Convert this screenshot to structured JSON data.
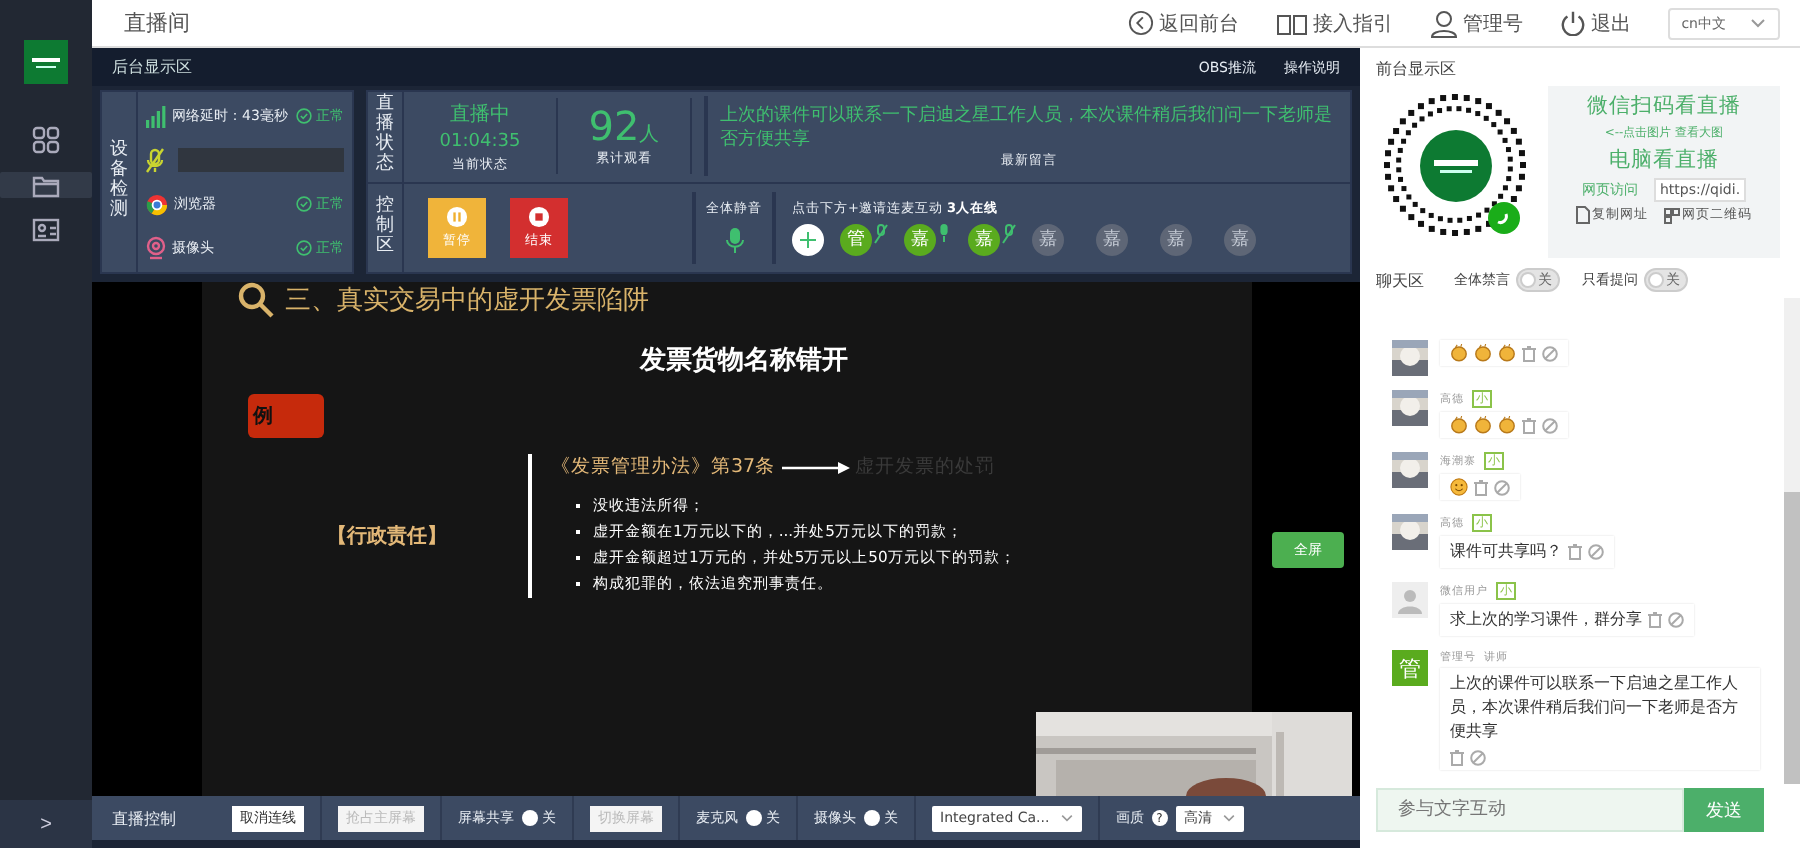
{
  "sidebar": {
    "items": [
      {
        "kind": "grid",
        "selected": false
      },
      {
        "kind": "folder",
        "selected": true
      },
      {
        "kind": "card",
        "selected": false
      }
    ],
    "expand": ">"
  },
  "header": {
    "title": "直播间",
    "links": [
      {
        "kind": "back",
        "label": "返回前台"
      },
      {
        "kind": "book",
        "label": "接入指引"
      },
      {
        "kind": "user",
        "label": "管理号"
      },
      {
        "kind": "power",
        "label": "退出"
      }
    ],
    "language": "cn中文"
  },
  "backstage": {
    "title": "后台显示区",
    "actions": [
      "OBS推流",
      "操作说明"
    ],
    "device_check": {
      "label": "设备检测",
      "rows": [
        {
          "kind": "network",
          "label": "网络延时：43毫秒",
          "status": "正常"
        },
        {
          "kind": "mic",
          "level": 0
        },
        {
          "kind": "browser",
          "label": "浏览器",
          "status": "正常"
        },
        {
          "kind": "camera",
          "label": "摄像头",
          "status": "正常"
        }
      ]
    },
    "live_status": {
      "label": "直播状态",
      "state": "直播中",
      "duration": "01:04:35",
      "state_caption": "当前状态",
      "viewers": "92",
      "viewers_unit": "人",
      "viewers_caption": "累计观看",
      "latest_message": "上次的课件可以联系一下启迪之星工作人员，本次课件稍后我们问一下老师是否方便共享",
      "latest_caption": "最新留言"
    },
    "control": {
      "label": "控制区",
      "buttons": [
        {
          "kind": "pause",
          "label": "暂停"
        },
        {
          "kind": "stop",
          "label": "结束"
        }
      ],
      "mute_all": "全体静音",
      "invite": "点击下方+邀请连麦互动 **3人在线**",
      "guests": [
        {
          "initial": "管",
          "online": true,
          "mic_on": false
        },
        {
          "initial": "嘉",
          "online": true,
          "mic_on": true
        },
        {
          "initial": "嘉",
          "online": true,
          "mic_on": false
        },
        {
          "initial": "嘉",
          "online": false
        },
        {
          "initial": "嘉",
          "online": false
        },
        {
          "initial": "嘉",
          "online": false
        },
        {
          "initial": "嘉",
          "online": false
        }
      ]
    }
  },
  "stage": {
    "slide": {
      "title": "三、真实交易中的虚开发票陷阱",
      "heading": "发票货物名称错开",
      "example": "例",
      "category": "【行政责任】",
      "source": "《发票管理办法》第37条",
      "target": "虚开发票的处罚",
      "bullets": [
        "没收违法所得；",
        "虚开金额在1万元以下的，...并处5万元以下的罚款；",
        "虚开金额超过1万元的，并处5万元以上50万元以下的罚款；",
        "构成犯罪的，依法追究刑事责任。"
      ]
    },
    "fullscreen": "全屏"
  },
  "controls": {
    "label": "直播控制",
    "items": [
      {
        "kind": "button",
        "label": "取消连线",
        "disabled": false
      },
      {
        "kind": "button",
        "label": "抢占主屏幕",
        "disabled": true
      },
      {
        "kind": "toggle",
        "label": "屏幕共享",
        "on": false,
        "state": "关"
      },
      {
        "kind": "button",
        "label": "切换屏幕",
        "disabled": true
      },
      {
        "kind": "toggle",
        "label": "麦克风",
        "on": false,
        "state": "关"
      },
      {
        "kind": "toggle",
        "label": "摄像头",
        "on": false,
        "state": "关"
      },
      {
        "kind": "select",
        "value": "Integrated Ca..."
      },
      {
        "kind": "select",
        "label": "画质",
        "help": "?",
        "value": "高清"
      }
    ]
  },
  "front": {
    "title": "前台显示区",
    "scan_title": "微信扫码看直播",
    "hint": "<--点击图片 查看大图",
    "pc_title": "电脑看直播",
    "web_label": "网页访问",
    "url": "https://qidi.",
    "copy": "复制网址",
    "qr": "网页二维码"
  },
  "chat": {
    "title": "聊天区",
    "toggles": [
      {
        "label": "全体禁言",
        "on": false,
        "state": "关"
      },
      {
        "label": "只看提问",
        "on": false,
        "state": "关"
      }
    ],
    "messages": [
      {
        "photo": true,
        "kind": "claps"
      },
      {
        "photo": true,
        "name": "高德",
        "tag": "小",
        "kind": "claps"
      },
      {
        "photo": true,
        "name": "海潮寨",
        "tag": "小",
        "kind": "smile"
      },
      {
        "photo": true,
        "name": "高德",
        "tag": "小",
        "kind": "text",
        "text": "课件可共享吗？"
      },
      {
        "photo": false,
        "name": "微信用户",
        "tag": "小",
        "kind": "text",
        "text": "求上次的学习课件，群分享"
      },
      {
        "initial": "管",
        "name": "管理号",
        "role": "讲师",
        "kind": "text",
        "text": "上次的课件可以联系一下启迪之星工作人员，本次课件稍后我们问一下老师是否方便共享"
      }
    ],
    "input": {
      "placeholder": "参与文字互动"
    },
    "send": "发送"
  }
}
